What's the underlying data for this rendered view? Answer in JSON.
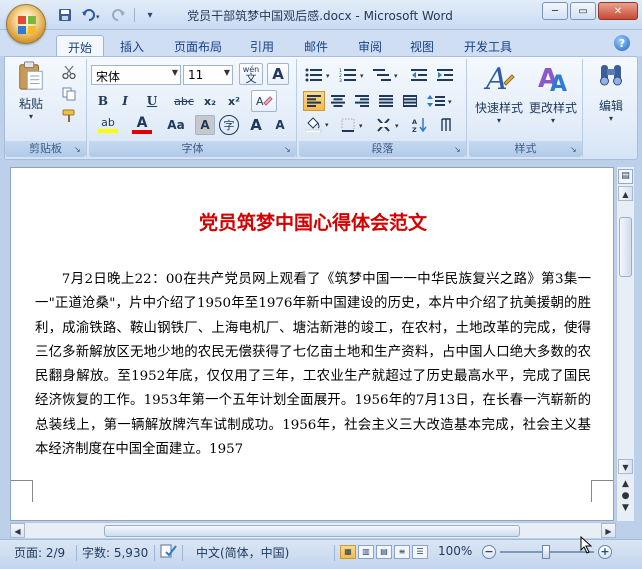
{
  "window": {
    "title": "党员干部筑梦中国观后感.docx - Microsoft Word",
    "minimize": "─",
    "restore": "▭",
    "close": "✕"
  },
  "quick_access": {
    "save_icon": "save-icon",
    "undo_icon": "undo-icon",
    "redo_icon": "redo-icon",
    "customize": "▾"
  },
  "tabs": [
    {
      "label": "开始",
      "active": true
    },
    {
      "label": "插入"
    },
    {
      "label": "页面布局"
    },
    {
      "label": "引用"
    },
    {
      "label": "邮件"
    },
    {
      "label": "审阅"
    },
    {
      "label": "视图"
    },
    {
      "label": "开发工具"
    }
  ],
  "help": "?",
  "ribbon": {
    "clipboard": {
      "label": "剪贴板",
      "paste": "粘贴",
      "paste_arrow": "▾"
    },
    "font": {
      "label": "字体",
      "font_name": "宋体",
      "font_size": "11",
      "wen": "wén",
      "wen_char": "文",
      "border_a": "A",
      "bold": "B",
      "italic": "I",
      "underline": "U",
      "strike": "abc",
      "subscript": "x₂",
      "superscript": "x²",
      "highlight": "ab",
      "font_color": "A",
      "change_case": "Aa",
      "char_shading": "A",
      "enclose": "字",
      "grow": "A",
      "shrink": "A"
    },
    "paragraph": {
      "label": "段落"
    },
    "styles": {
      "label": "样式",
      "quick_styles": "快速样式",
      "change_styles": "更改样式"
    },
    "editing": {
      "label": "编辑",
      "edit": "编辑"
    }
  },
  "document": {
    "heading": "党员筑梦中国心得体会范文",
    "body": "7月2日晚上22：00在共产党员网上观看了《筑梦中国一一中华民族复兴之路》第3集一一\"正道沧桑\"，片中介绍了1950年至1976年新中国建设的历史，本片中介绍了抗美援朝的胜利，成渝铁路、鞍山钢铁厂、上海电机厂、塘沽新港的竣工，在农村，土地改革的完成，使得三亿多新解放区无地少地的农民无偿获得了七亿亩土地和生产资料，占中国人口绝大多数的农民翻身解放。至1952年底，仅仅用了三年，工农业生产就超过了历史最高水平，完成了国民经济恢复的工作。1953年第一个五年计划全面展开。1956年的7月13日，在长春一汽崭新的总装线上，第一辆解放牌汽车试制成功。1956年，社会主义三大改造基本完成，社会主义基本经济制度在中国全面建立。1957"
  },
  "status": {
    "page": "页面: 2/9",
    "words": "字数: 5,930",
    "language": "中文(简体，中国)",
    "zoom": "100%",
    "zoom_minus": "−",
    "zoom_plus": "+"
  }
}
